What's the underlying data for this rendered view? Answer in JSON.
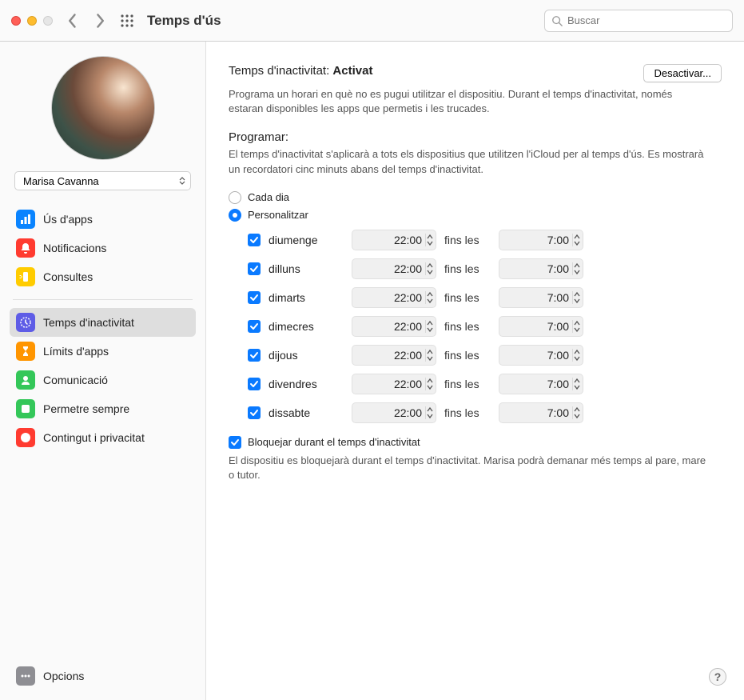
{
  "window": {
    "title": "Temps d'ús",
    "search_placeholder": "Buscar"
  },
  "sidebar": {
    "user": "Marisa Cavanna",
    "items_top": [
      {
        "label": "Ús d'apps",
        "icon": "chart"
      },
      {
        "label": "Notificacions",
        "icon": "bell"
      },
      {
        "label": "Consultes",
        "icon": "pickup"
      }
    ],
    "items_mid": [
      {
        "label": "Temps d'inactivitat",
        "icon": "downtime",
        "selected": true
      },
      {
        "label": "Límits d'apps",
        "icon": "limits"
      },
      {
        "label": "Comunicació",
        "icon": "comm"
      },
      {
        "label": "Permetre sempre",
        "icon": "allow"
      },
      {
        "label": "Contingut i privacitat",
        "icon": "content"
      }
    ],
    "options_label": "Opcions"
  },
  "main": {
    "heading_prefix": "Temps d'inactivitat: ",
    "heading_status": "Activat",
    "disable_button": "Desactivar...",
    "heading_desc": "Programa un horari en què no es pugui utilitzar el dispositiu. Durant el temps d'inactivitat, només estaran disponibles les apps que permetis i les trucades.",
    "schedule_title": "Programar:",
    "schedule_desc": "El temps d'inactivitat s'aplicarà a tots els dispositius que utilitzen l'iCloud per al temps d'ús. Es mostrarà un recordatori cinc minuts abans del temps d'inactivitat.",
    "radio_every_day": "Cada dia",
    "radio_custom": "Personalitzar",
    "separator": "fins les",
    "days": [
      {
        "name": "diumenge",
        "checked": true,
        "from": "22:00",
        "to": "7:00"
      },
      {
        "name": "dilluns",
        "checked": true,
        "from": "22:00",
        "to": "7:00"
      },
      {
        "name": "dimarts",
        "checked": true,
        "from": "22:00",
        "to": "7:00"
      },
      {
        "name": "dimecres",
        "checked": true,
        "from": "22:00",
        "to": "7:00"
      },
      {
        "name": "dijous",
        "checked": true,
        "from": "22:00",
        "to": "7:00"
      },
      {
        "name": "divendres",
        "checked": true,
        "from": "22:00",
        "to": "7:00"
      },
      {
        "name": "dissabte",
        "checked": true,
        "from": "22:00",
        "to": "7:00"
      }
    ],
    "block_checkbox": "Bloquejar durant el temps d'inactivitat",
    "block_desc": "El dispositiu es bloquejarà durant el temps d'inactivitat. Marisa podrà demanar més temps al pare, mare o tutor."
  }
}
